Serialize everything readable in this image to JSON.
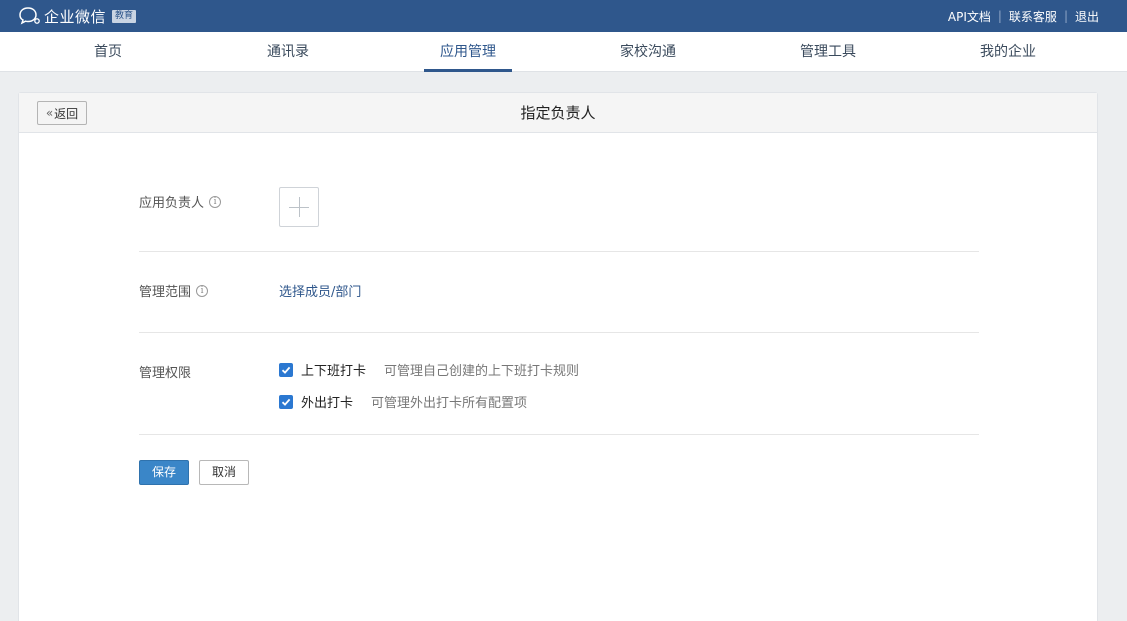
{
  "header": {
    "logo_text": "企业微信",
    "logo_badge": "教育",
    "links": [
      "API文档",
      "联系客服",
      "退出"
    ],
    "separator": "|"
  },
  "nav": {
    "items": [
      {
        "label": "首页",
        "active": false
      },
      {
        "label": "通讯录",
        "active": false
      },
      {
        "label": "应用管理",
        "active": true
      },
      {
        "label": "家校沟通",
        "active": false
      },
      {
        "label": "管理工具",
        "active": false
      },
      {
        "label": "我的企业",
        "active": false
      }
    ]
  },
  "page": {
    "back_label": "返回",
    "title": "指定负责人"
  },
  "form": {
    "owner_label": "应用负责人",
    "scope_label": "管理范围",
    "scope_link": "选择成员/部门",
    "permission_label": "管理权限",
    "permissions": [
      {
        "name": "上下班打卡",
        "desc": "可管理自己创建的上下班打卡规则",
        "checked": true
      },
      {
        "name": "外出打卡",
        "desc": "可管理外出打卡所有配置项",
        "checked": true
      }
    ],
    "save_label": "保存",
    "cancel_label": "取消"
  },
  "colors": {
    "topbar": "#2f578c",
    "accent": "#2f578c",
    "primary_button": "#3a86c8",
    "checkbox": "#2b78d1"
  }
}
